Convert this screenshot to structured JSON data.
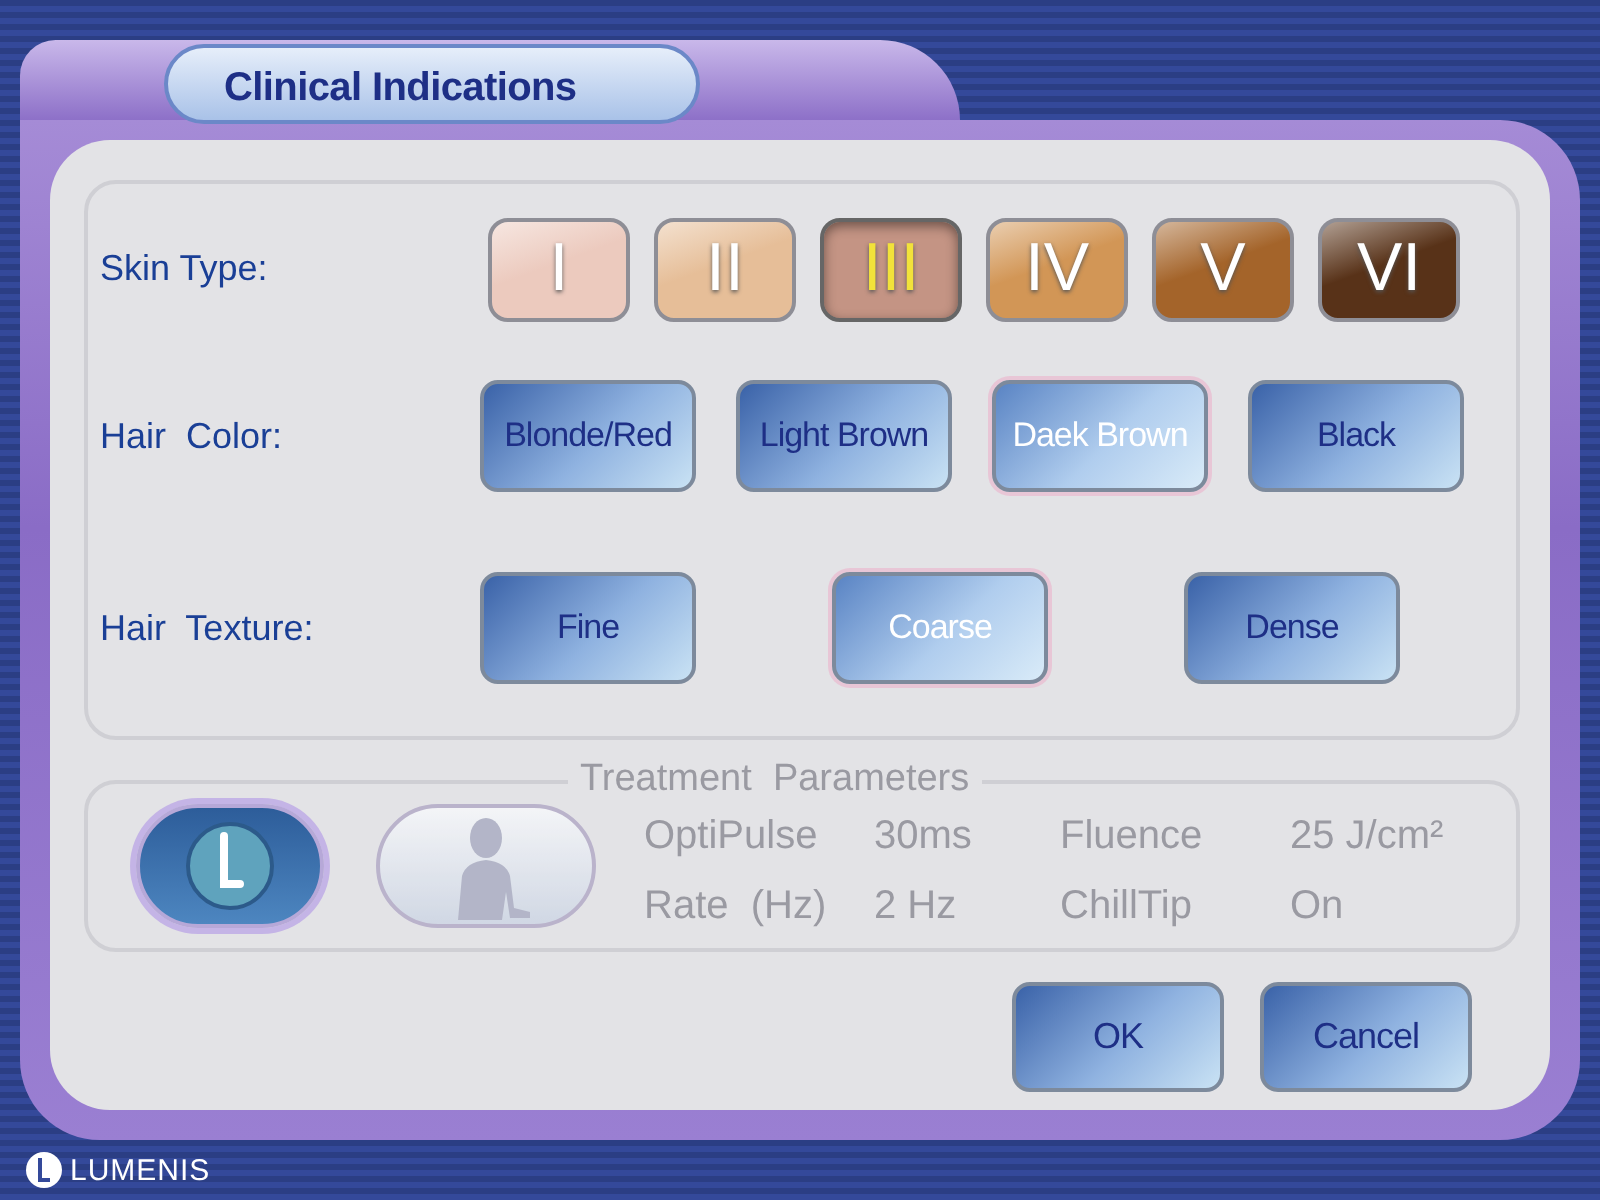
{
  "title": "Clinical Indications",
  "rows": [
    {
      "label": "Skin Type:",
      "kind": "skin",
      "options": [
        {
          "label": "I",
          "selected": false,
          "color": "#eccabe"
        },
        {
          "label": "II",
          "selected": false,
          "color": "#e6be98"
        },
        {
          "label": "III",
          "selected": true,
          "color": "#c49484"
        },
        {
          "label": "IV",
          "selected": false,
          "color": "#d29656"
        },
        {
          "label": "V",
          "selected": false,
          "color": "#a4642a"
        },
        {
          "label": "VI",
          "selected": false,
          "color": "#583218"
        }
      ]
    },
    {
      "label": "Hair  Color:",
      "kind": "hair",
      "options": [
        {
          "label": "Blonde/Red",
          "selected": false
        },
        {
          "label": "Light Brown",
          "selected": false
        },
        {
          "label": "Daek Brown",
          "selected": true
        },
        {
          "label": "Black",
          "selected": false
        }
      ]
    },
    {
      "label": "Hair  Texture:",
      "kind": "texture",
      "options": [
        {
          "label": "Fine",
          "selected": false
        },
        {
          "label": "Coarse",
          "selected": true
        },
        {
          "label": "Dense",
          "selected": false
        }
      ]
    }
  ],
  "treatment": {
    "legend": "Treatment  Parameters",
    "modes": [
      {
        "kind": "pulse",
        "selected": true
      },
      {
        "kind": "person",
        "selected": false
      }
    ],
    "params": [
      {
        "name": "OptiPulse",
        "value": "30ms"
      },
      {
        "name": "Fluence",
        "value": "25 J/cm²"
      },
      {
        "name": "Rate  (Hz)",
        "value": "2 Hz"
      },
      {
        "name": "ChillTip",
        "value": "On"
      }
    ]
  },
  "buttons": [
    "OK",
    "Cancel"
  ],
  "logo": "LUMENIS"
}
